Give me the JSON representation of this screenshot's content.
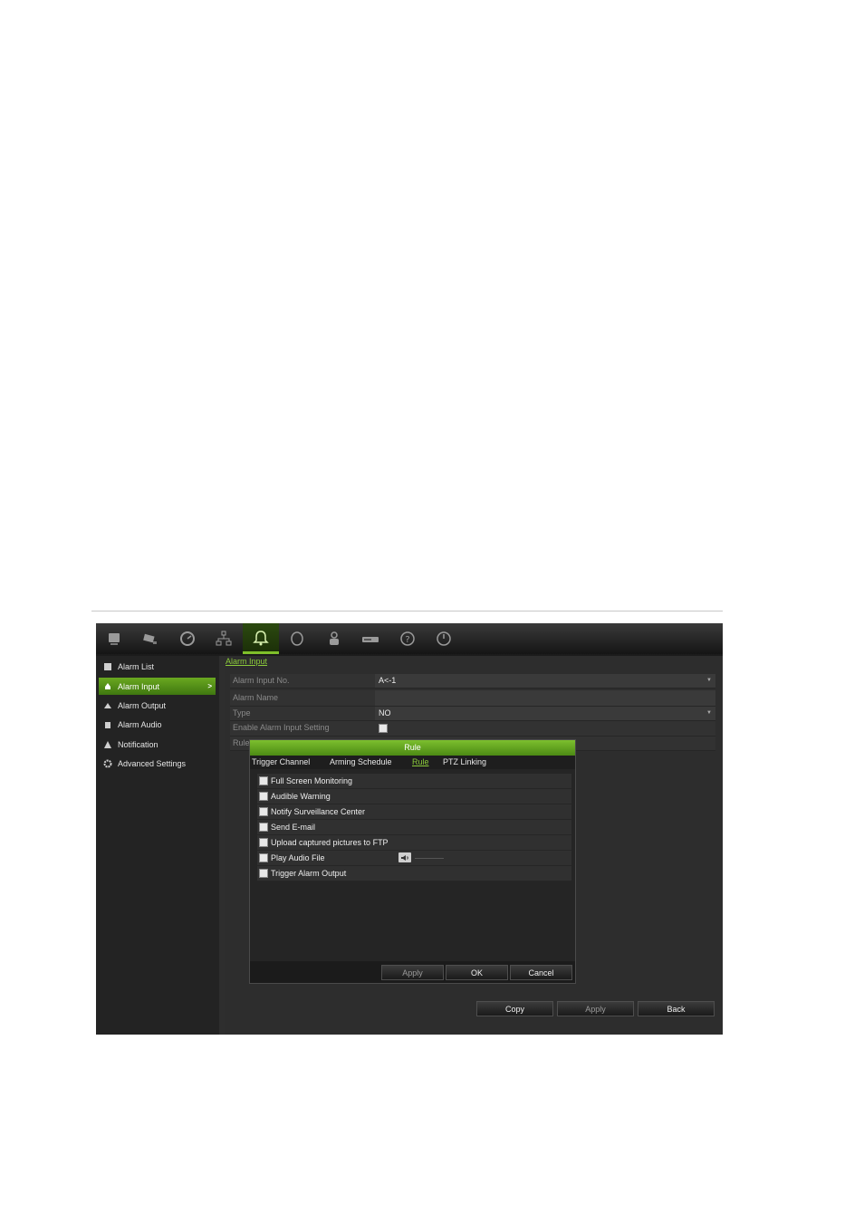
{
  "topbar": {
    "icons": [
      "monitor-icon",
      "camera-icon",
      "clock-icon",
      "network-icon",
      "bell-icon",
      "disk-icon",
      "user-icon",
      "device-icon",
      "help-icon",
      "power-icon"
    ],
    "active_index": 4
  },
  "sidebar": {
    "items": [
      {
        "label": "Alarm List",
        "icon": "alarm-list-icon",
        "active": false
      },
      {
        "label": "Alarm Input",
        "icon": "alarm-input-icon",
        "active": true,
        "arrow": ">"
      },
      {
        "label": "Alarm Output",
        "icon": "alarm-output-icon",
        "active": false
      },
      {
        "label": "Alarm Audio",
        "icon": "alarm-audio-icon",
        "active": false
      },
      {
        "label": "Notification",
        "icon": "notification-icon",
        "active": false
      },
      {
        "label": "Advanced Settings",
        "icon": "gear-icon",
        "active": false
      }
    ]
  },
  "main": {
    "breadcrumb": "Alarm Input",
    "fields": {
      "alarm_input_no": {
        "label": "Alarm Input No.",
        "value": "A<-1"
      },
      "alarm_name": {
        "label": "Alarm Name",
        "value": ""
      },
      "type": {
        "label": "Type",
        "value": "NO"
      },
      "enable": {
        "label": "Enable Alarm Input Setting",
        "checked": false
      },
      "rule": {
        "label": "Rule"
      }
    },
    "buttons": {
      "copy": "Copy",
      "apply": "Apply",
      "back": "Back"
    }
  },
  "dialog": {
    "title": "Rule",
    "tabs": [
      "Trigger Channel",
      "Arming Schedule",
      "Rule",
      "PTZ Linking"
    ],
    "active_tab": "Rule",
    "options": [
      "Full Screen Monitoring",
      "Audible Warning",
      "Notify Surveillance Center",
      "Send E-mail",
      "Upload captured pictures to FTP",
      "Play Audio File",
      "Trigger Alarm Output"
    ],
    "buttons": {
      "apply": "Apply",
      "ok": "OK",
      "cancel": "Cancel"
    }
  },
  "colors": {
    "accent": "#7fc02a",
    "background": "#1b1b1b"
  }
}
